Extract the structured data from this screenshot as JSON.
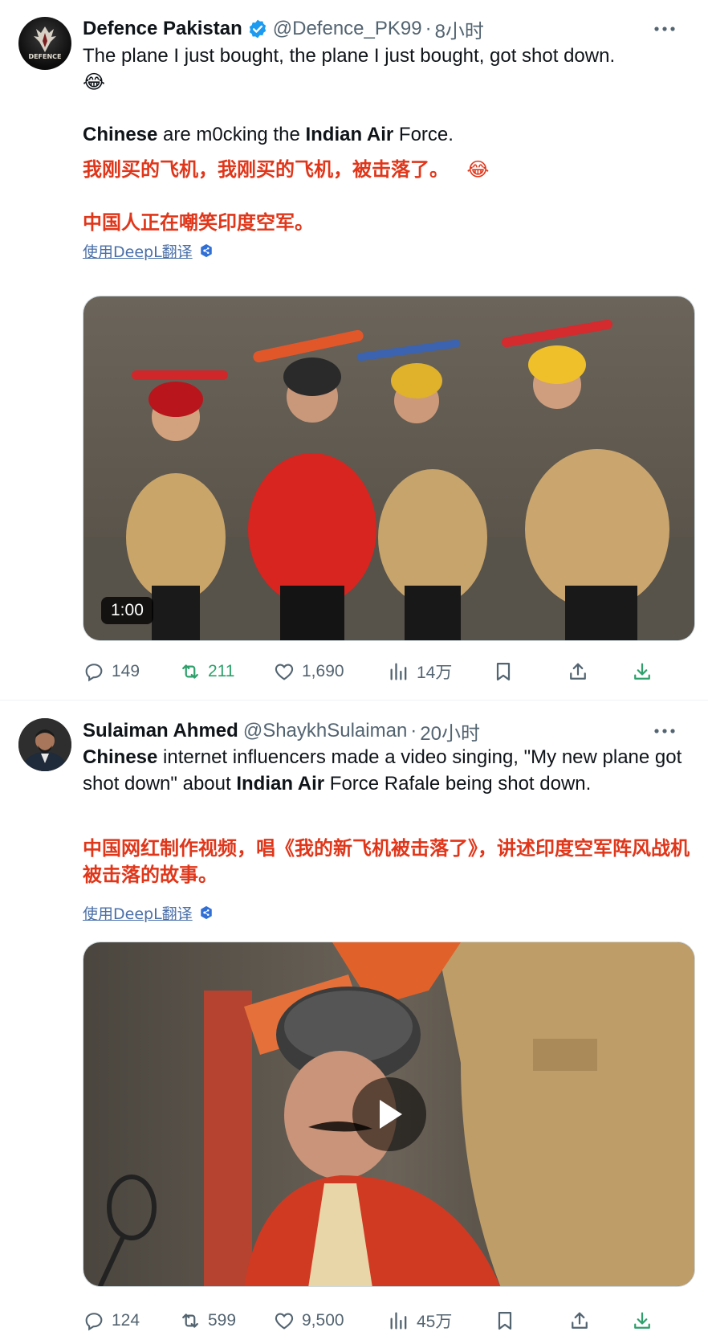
{
  "tweets": [
    {
      "author": {
        "name": "Defence Pakistan",
        "handle": "@Defence_PK99",
        "time": "8小时",
        "avatar_text": "DEFENCE"
      },
      "text_en_1": "The plane I just bought, the plane I just bought, got shot down.",
      "text_en_1_emoji": "😂",
      "text_en_2_parts": [
        "Chinese",
        " are m0cking the ",
        "Indian Air",
        " Force."
      ],
      "text_zh_1": "我刚买的飞机，我刚买的飞机，被击落了。",
      "text_zh_1_emoji": "😂",
      "text_zh_2": "中国人正在嘲笑印度空军。",
      "translate_label": "使用DeepL翻译",
      "media": {
        "type": "video",
        "duration": "1:00"
      },
      "actions": {
        "replies": "149",
        "retweets": "211",
        "likes": "1,690",
        "views": "14万"
      }
    },
    {
      "author": {
        "name": "Sulaiman Ahmed",
        "handle": "@ShaykhSulaiman",
        "time": "20小时"
      },
      "text_en_parts": [
        "Chinese",
        " internet influencers made a video singing, \"My new plane got shot down\" about ",
        "Indian Air",
        " Force Rafale being shot down."
      ],
      "text_zh": "中国网红制作视频，唱《我的新飞机被击落了》，讲述印度空军阵风战机被击落的故事。",
      "translate_label": "使用DeepL翻译",
      "media": {
        "type": "video"
      },
      "actions": {
        "replies": "124",
        "retweets": "599",
        "likes": "9,500",
        "views": "45万"
      }
    }
  ],
  "colors": {
    "accent_blue": "#1d9bf0",
    "retweet_green": "#00ba7c",
    "chinese_text_red": "#e0361a",
    "translate_link": "#4a6fa8"
  },
  "icons": [
    "verified-badge-icon",
    "more-icon",
    "reply-icon",
    "retweet-icon",
    "like-icon",
    "views-icon",
    "bookmark-icon",
    "share-icon",
    "download-icon",
    "play-icon",
    "translate-badge-icon"
  ]
}
